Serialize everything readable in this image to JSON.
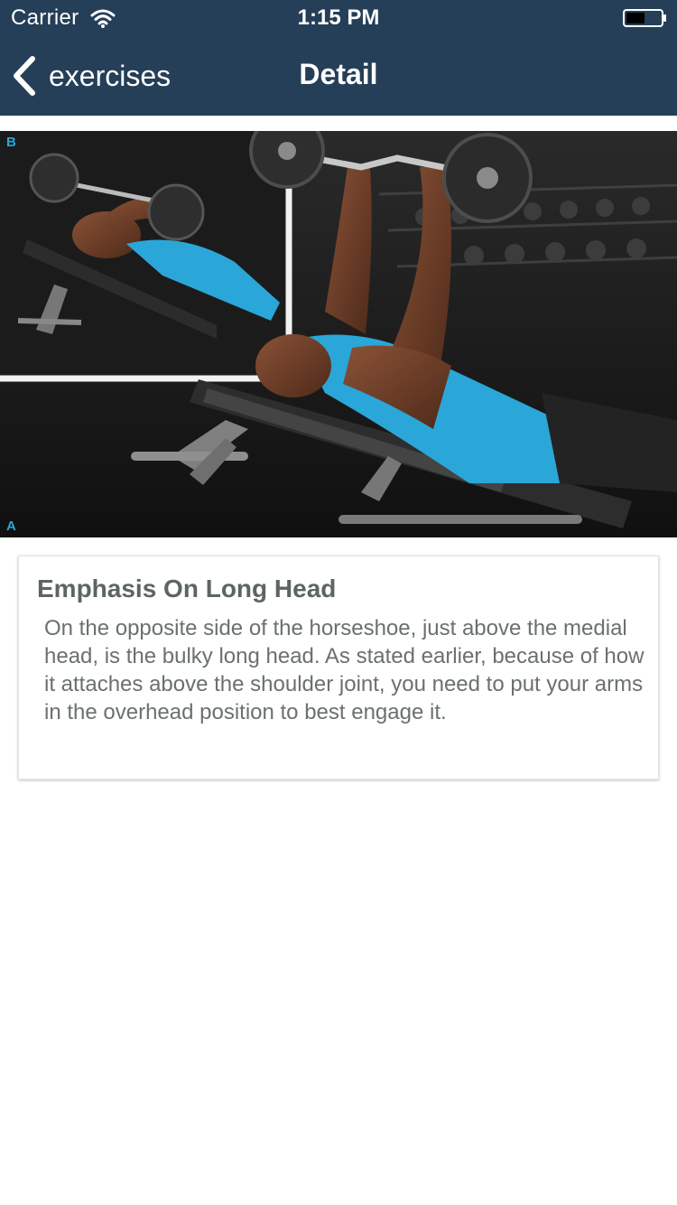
{
  "status_bar": {
    "carrier": "Carrier",
    "time": "1:15 PM",
    "wifi_icon": "wifi-icon",
    "battery_icon": "battery-icon"
  },
  "nav": {
    "back_label": "exercises",
    "back_icon": "chevron-left-icon",
    "title": "Detail",
    "background_color": "#243f57"
  },
  "hero_image": {
    "photo_labels": [
      "B",
      "A"
    ],
    "accent_color": "#2aa7d8"
  },
  "card": {
    "title": "Emphasis On Long Head",
    "body": "On the opposite side of the horseshoe, just above the medial head, is the bulky long head. As stated earlier, because of how it attaches above the shoulder joint, you need to put your arms in the overhead position to best engage it."
  }
}
